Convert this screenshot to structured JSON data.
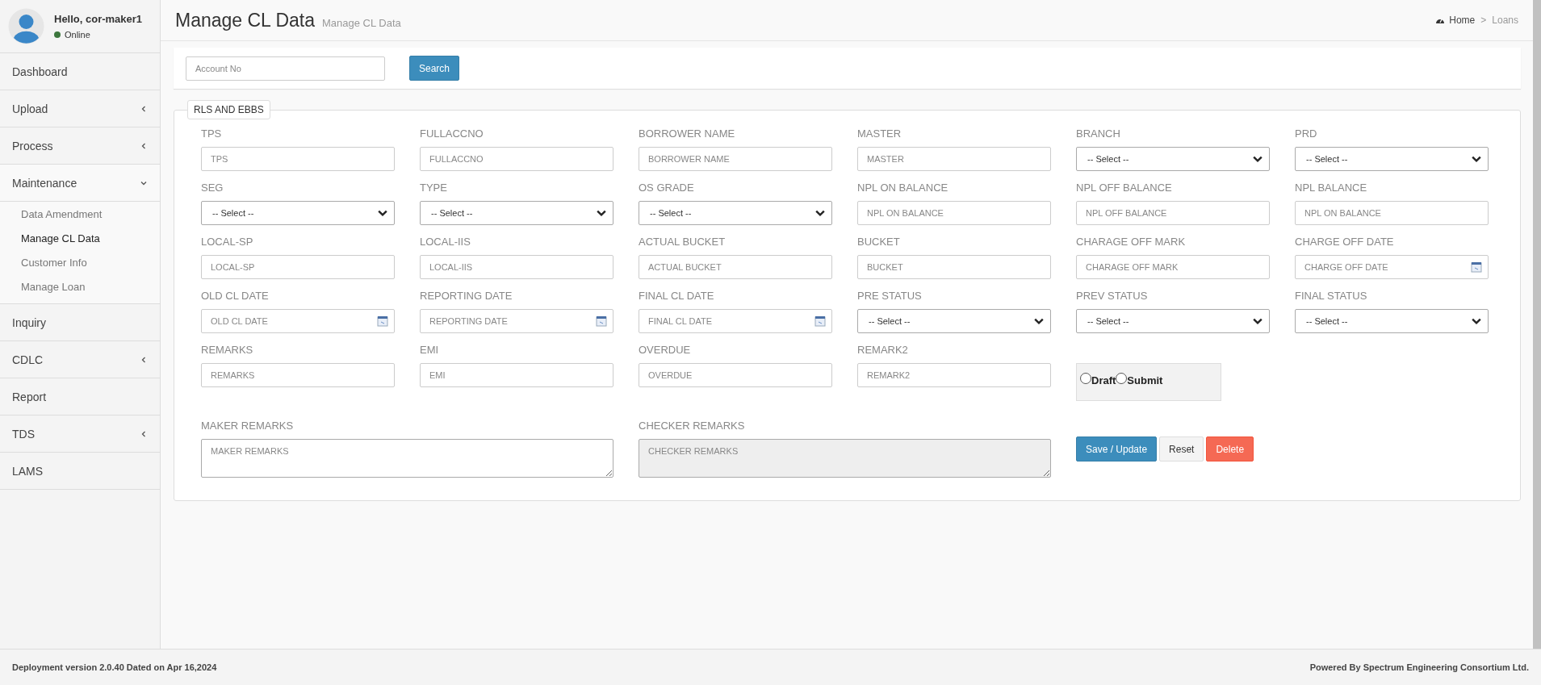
{
  "user": {
    "greeting": "Hello, cor-maker1",
    "status": "Online",
    "online": true
  },
  "sidebar": {
    "items": [
      {
        "label": "Dashboard",
        "kind": "link"
      },
      {
        "label": "Upload",
        "kind": "menu",
        "expanded": false
      },
      {
        "label": "Process",
        "kind": "menu",
        "expanded": false
      },
      {
        "label": "Maintenance",
        "kind": "menu",
        "expanded": true,
        "children": [
          {
            "label": "Data Amendment",
            "selected": false
          },
          {
            "label": "Manage CL Data",
            "selected": true
          },
          {
            "label": "Customer Info",
            "selected": false
          },
          {
            "label": "Manage Loan",
            "selected": false
          }
        ]
      },
      {
        "label": "Inquiry",
        "kind": "link"
      },
      {
        "label": "CDLC",
        "kind": "menu",
        "expanded": false
      },
      {
        "label": "Report",
        "kind": "link"
      },
      {
        "label": "TDS",
        "kind": "menu",
        "expanded": false
      },
      {
        "label": "LAMS",
        "kind": "link"
      }
    ]
  },
  "header": {
    "title": "Manage CL Data",
    "subtitle": "Manage CL Data",
    "breadcrumb": [
      "Home",
      "Loans"
    ],
    "separator": ">"
  },
  "search": {
    "placeholder": "Account No",
    "button": "Search"
  },
  "form": {
    "legend": "RLS AND EBBS",
    "fields": [
      {
        "label": "TPS",
        "kind": "text",
        "placeholder": "TPS"
      },
      {
        "label": "FULLACCNO",
        "kind": "text",
        "placeholder": "FULLACCNO"
      },
      {
        "label": "BORROWER NAME",
        "kind": "text",
        "placeholder": "BORROWER NAME"
      },
      {
        "label": "MASTER",
        "kind": "text",
        "placeholder": "MASTER"
      },
      {
        "label": "BRANCH",
        "kind": "select",
        "value": "-- Select --"
      },
      {
        "label": "PRD",
        "kind": "select",
        "value": "-- Select --"
      },
      {
        "label": "SEG",
        "kind": "select",
        "value": "-- Select --"
      },
      {
        "label": "TYPE",
        "kind": "select",
        "value": "-- Select --"
      },
      {
        "label": "OS GRADE",
        "kind": "select",
        "value": "-- Select --"
      },
      {
        "label": "NPL ON BALANCE",
        "kind": "text",
        "placeholder": "NPL ON BALANCE"
      },
      {
        "label": "NPL OFF BALANCE",
        "kind": "text",
        "placeholder": "NPL OFF BALANCE"
      },
      {
        "label": "NPL BALANCE",
        "kind": "text",
        "placeholder": "NPL ON BALANCE"
      },
      {
        "label": "LOCAL-SP",
        "kind": "text",
        "placeholder": "LOCAL-SP"
      },
      {
        "label": "LOCAL-IIS",
        "kind": "text",
        "placeholder": "LOCAL-IIS"
      },
      {
        "label": "ACTUAL BUCKET",
        "kind": "text",
        "placeholder": "ACTUAL BUCKET"
      },
      {
        "label": "BUCKET",
        "kind": "text",
        "placeholder": "BUCKET"
      },
      {
        "label": "CHARAGE OFF MARK",
        "kind": "text",
        "placeholder": "CHARAGE OFF MARK"
      },
      {
        "label": "CHARGE OFF DATE",
        "kind": "date",
        "placeholder": "CHARGE OFF DATE"
      },
      {
        "label": "OLD CL DATE",
        "kind": "date",
        "placeholder": "OLD CL DATE"
      },
      {
        "label": "REPORTING DATE",
        "kind": "date",
        "placeholder": "REPORTING DATE"
      },
      {
        "label": "FINAL CL DATE",
        "kind": "date",
        "placeholder": "FINAL CL DATE"
      },
      {
        "label": "PRE STATUS",
        "kind": "select",
        "value": "-- Select --"
      },
      {
        "label": "PREV STATUS",
        "kind": "select",
        "value": "-- Select --"
      },
      {
        "label": "FINAL STATUS",
        "kind": "select",
        "value": "-- Select --"
      },
      {
        "label": "REMARKS",
        "kind": "text",
        "placeholder": "REMARKS"
      },
      {
        "label": "EMI",
        "kind": "text",
        "placeholder": "EMI"
      },
      {
        "label": "OVERDUE",
        "kind": "text",
        "placeholder": "OVERDUE"
      },
      {
        "label": "REMARK2",
        "kind": "text",
        "placeholder": "REMARK2"
      },
      {
        "kind": "radios",
        "options": [
          {
            "label": "Draft",
            "selected": false
          },
          {
            "label": "Submit",
            "selected": false
          }
        ]
      },
      {
        "label": "MAKER REMARKS",
        "kind": "textarea",
        "placeholder": "MAKER REMARKS",
        "disabled": false
      },
      {
        "label": "CHECKER REMARKS",
        "kind": "textarea",
        "placeholder": "CHECKER REMARKS",
        "disabled": true
      },
      {
        "kind": "buttons",
        "buttons": [
          {
            "label": "Save / Update",
            "kind": "primary"
          },
          {
            "label": "Reset",
            "kind": "default"
          },
          {
            "label": "Delete",
            "kind": "danger"
          }
        ]
      }
    ]
  },
  "footer": {
    "left": "Deployment version 2.0.40 Dated on Apr 16,2024",
    "right": "Powered By Spectrum Engineering Consortium Ltd."
  }
}
